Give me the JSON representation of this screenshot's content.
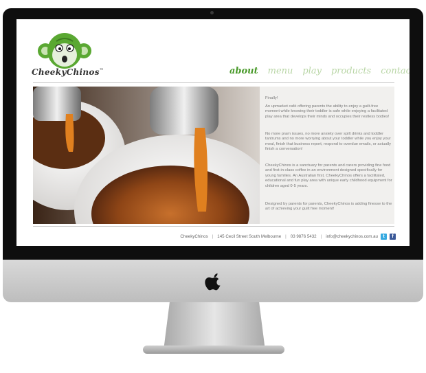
{
  "brand": {
    "name": "CheekyChinos",
    "tm": "™"
  },
  "nav": [
    "about",
    "menu",
    "play",
    "products",
    "contact"
  ],
  "content": {
    "p1": "Finally!",
    "p2": "An upmarket café offering parents the ability to enjoy a guilt-free moment while knowing their toddler is safe while enjoying a facilitated play area that develops their minds and occupies their restless bodies!",
    "p3": "No more pram issues, no more anxiety over spilt drinks and toddler tantrums and no more worrying about your toddler while you enjoy your meal, finish that business report, respond to overdue emails, or actually finish a conversation!",
    "p4": "CheekyChinos is a sanctuary for parents and carers providing fine food and first-in-class coffee in an environment designed specifically for young families. An Australian first, CheekyChinos offers a facilitated, educational and fun play area with unique early childhood equipment for children aged 0-5 years.",
    "p5": "Designed by parents for parents, CheekyChinos is adding finesse to the art of achieving your guilt free moment!"
  },
  "footer": {
    "name": "CheekyChinos",
    "address": "145 Cecil Street South Melbourne",
    "phone": "03 9876 5432",
    "email": "info@cheekychinos.com.au",
    "twitter": "t",
    "facebook": "f"
  },
  "colors": {
    "brand_green": "#4a9a2b",
    "nav_inactive": "#b9d6a6",
    "bezel": "#0e0e0e"
  }
}
